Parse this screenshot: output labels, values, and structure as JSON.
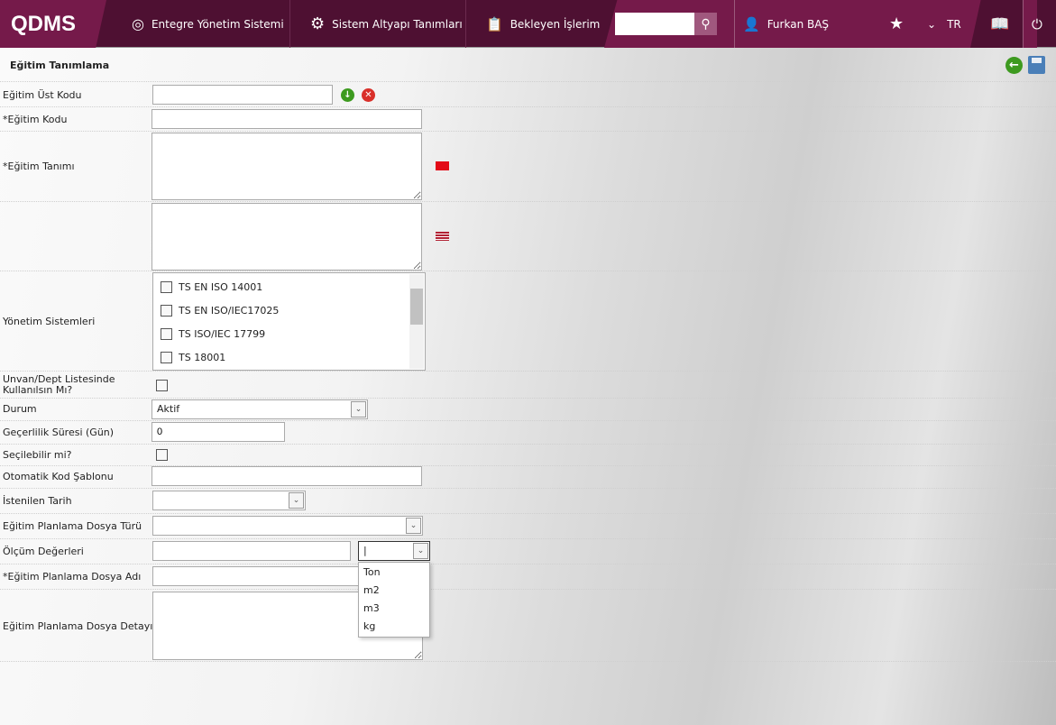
{
  "header": {
    "logo": "QDMS",
    "nav": [
      {
        "label": "Entegre Yönetim Sistemi",
        "icon": "q-icon"
      },
      {
        "label": "Sistem Altyapı Tanımları",
        "icon": "gear-icon"
      },
      {
        "label": "Bekleyen İşlerim",
        "icon": "clipboard-icon"
      }
    ],
    "search": {
      "value": "",
      "placeholder": ""
    },
    "user": "Furkan BAŞ",
    "language": "TR",
    "colors": {
      "primary": "#4e1032",
      "accent": "#751a4a"
    }
  },
  "page": {
    "title": "Eğitim Tanımlama"
  },
  "form": {
    "ust_kodu": {
      "label": "Eğitim Üst Kodu",
      "value": ""
    },
    "kodu": {
      "label": "*Eğitim Kodu",
      "value": ""
    },
    "tanimi": {
      "label": "*Eğitim Tanımı",
      "value_tr": "",
      "value_en": ""
    },
    "yonetim": {
      "label": "Yönetim Sistemleri",
      "options": [
        "TS EN ISO 14001",
        "TS EN ISO/IEC17025",
        "TS ISO/IEC 17799",
        "TS 18001"
      ]
    },
    "unvan": {
      "label": "Unvan/Dept Listesinde Kullanılsın Mı?",
      "checked": false
    },
    "durum": {
      "label": "Durum",
      "value": "Aktif"
    },
    "gecerlilik": {
      "label": "Geçerlilik Süresi (Gün)",
      "value": "0"
    },
    "secilebilir": {
      "label": "Seçilebilir mi?",
      "checked": false
    },
    "sablon": {
      "label": "Otomatik Kod Şablonu",
      "value": ""
    },
    "tarih": {
      "label": "İstenilen Tarih",
      "value": ""
    },
    "dosya_turu": {
      "label": "Eğitim Planlama Dosya Türü",
      "value": ""
    },
    "olcum": {
      "label": "Ölçüm Değerleri",
      "value": "",
      "unit": "",
      "unit_options": [
        "Ton",
        "m2",
        "m3",
        "kg"
      ]
    },
    "dosya_adi": {
      "label": "*Eğitim Planlama Dosya Adı",
      "value": ""
    },
    "dosya_detay": {
      "label": "Eğitim Planlama Dosya Detayı",
      "value": ""
    }
  }
}
